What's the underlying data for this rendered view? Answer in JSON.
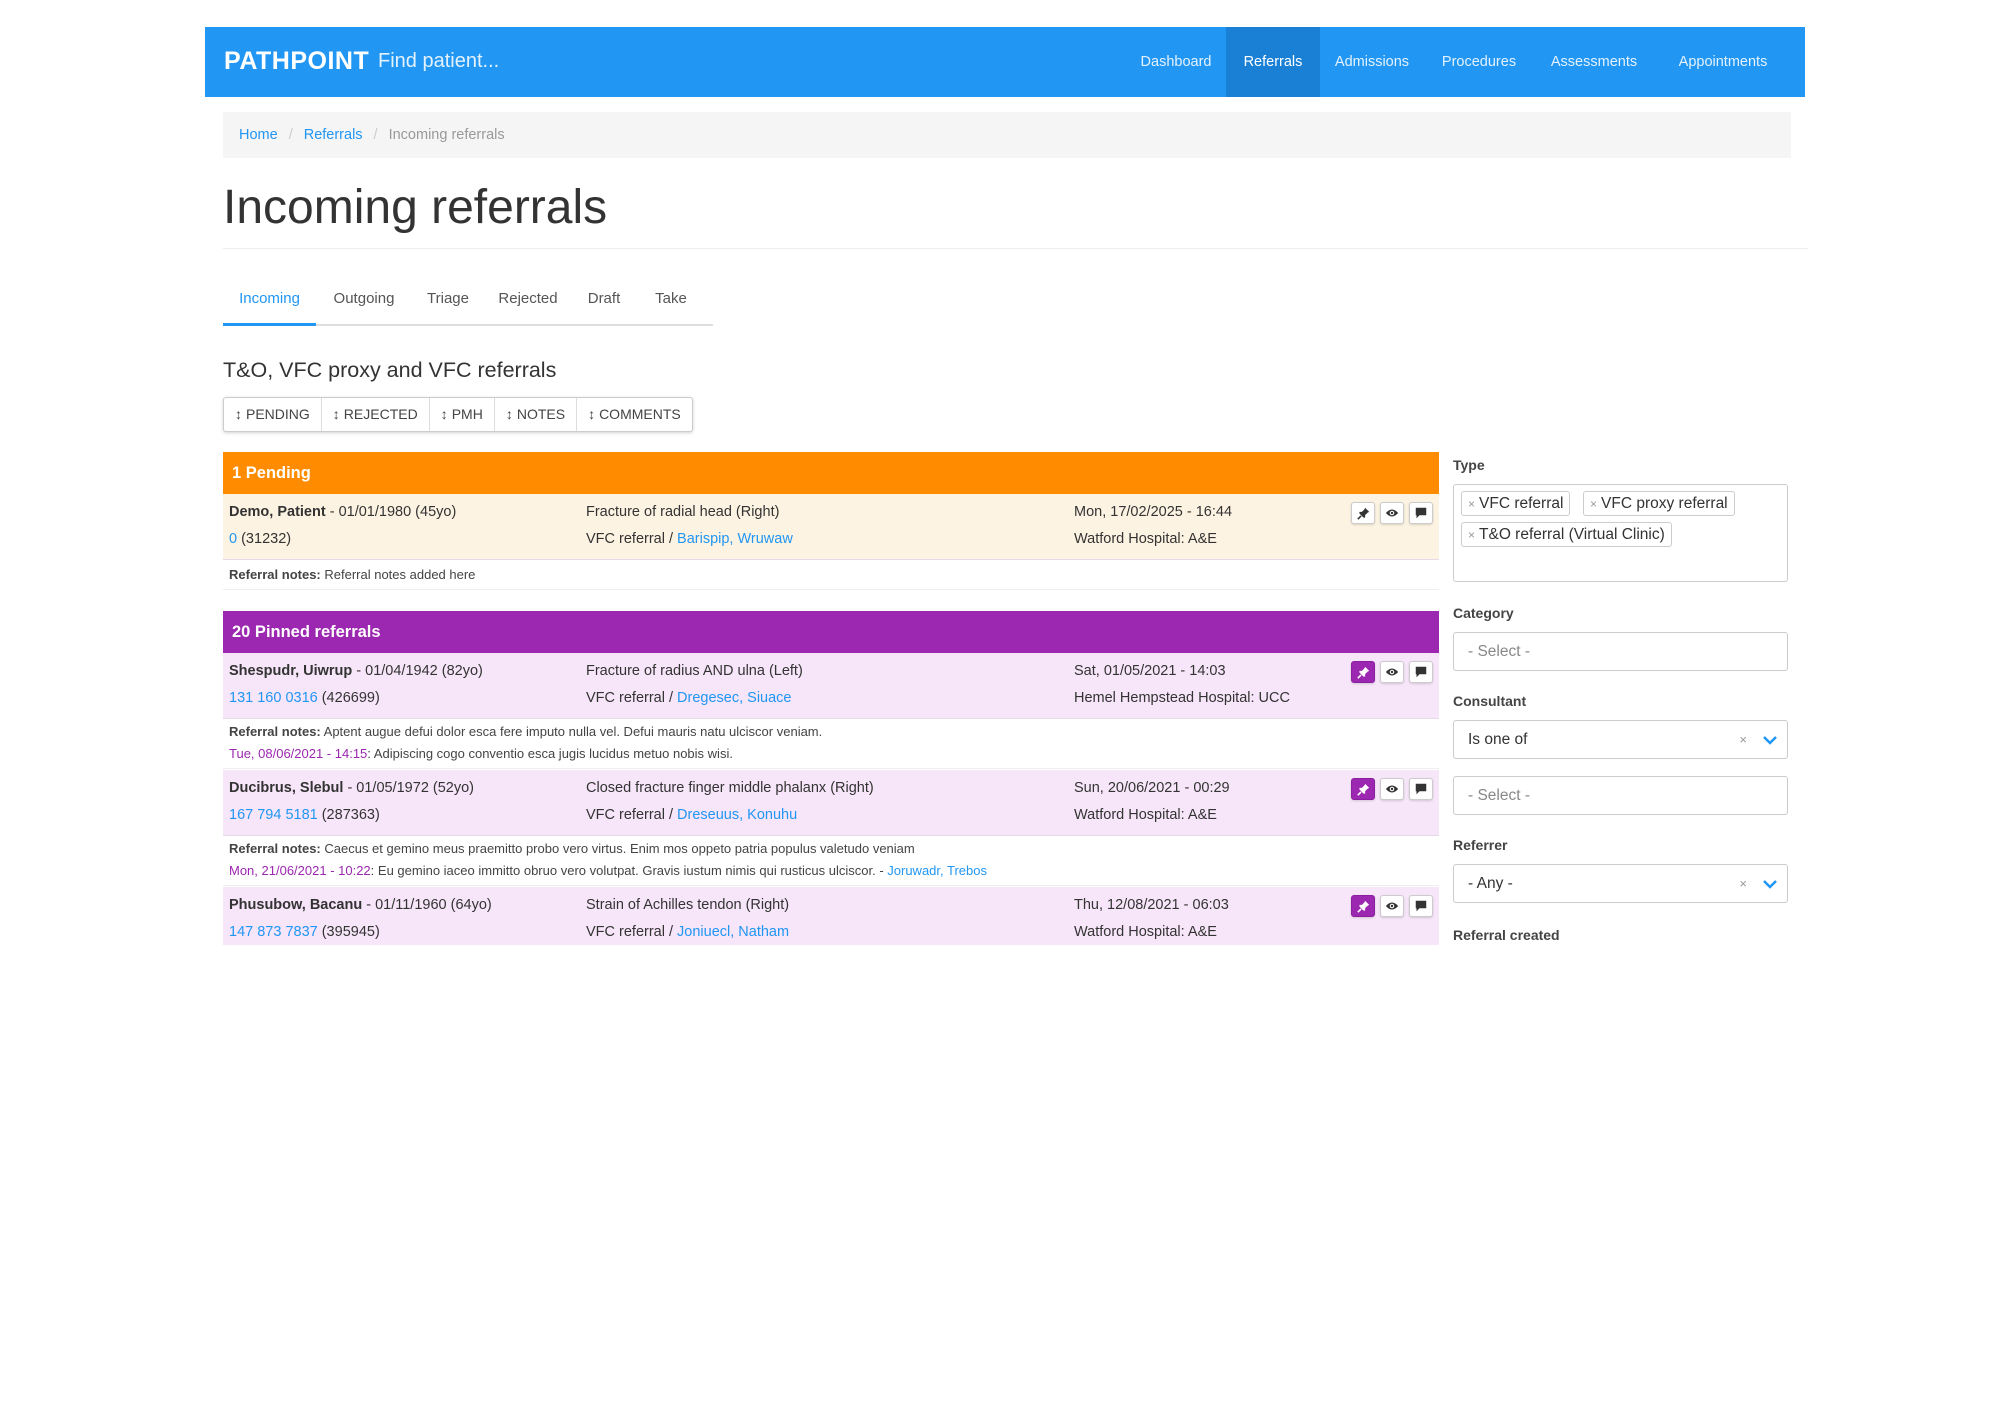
{
  "nav": {
    "brand": "PATHPOINT",
    "find_placeholder": "Find patient...",
    "items": [
      "Dashboard",
      "Referrals",
      "Admissions",
      "Procedures",
      "Assessments",
      "Appointments"
    ],
    "active_item": "Referrals"
  },
  "breadcrumb": {
    "home": "Home",
    "referrals": "Referrals",
    "current": "Incoming referrals"
  },
  "page_title": "Incoming referrals",
  "tabs": [
    "Incoming",
    "Outgoing",
    "Triage",
    "Rejected",
    "Draft",
    "Take"
  ],
  "active_tab": "Incoming",
  "section_title": "T&O, VFC proxy and VFC referrals",
  "sort_buttons": [
    "PENDING",
    "REJECTED",
    "PMH",
    "NOTES",
    "COMMENTS"
  ],
  "colors": {
    "nav": "#2196f3",
    "pending": "#ff8c00",
    "pinned": "#9c27b0",
    "pending_row": "#fdf3e2",
    "pinned_row": "#f7e6f9",
    "link": "#2196f3"
  },
  "pending": {
    "header": "1 Pending",
    "rows": [
      {
        "name": "Demo, Patient",
        "dob": " - 01/01/1980 (45yo)",
        "id_link": "0",
        "id_extra": " (31232)",
        "diagnosis": "Fracture of radial head (Right)",
        "type_prefix": "VFC referral / ",
        "referrer": "Barispip, Wruwaw",
        "datetime": "Mon, 17/02/2025 - 16:44",
        "location": "Watford Hospital: A&E",
        "notes_label": "Referral notes:",
        "notes": " Referral notes added here"
      }
    ]
  },
  "pinned": {
    "header": "20 Pinned referrals",
    "rows": [
      {
        "name": "Shespudr, Uiwrup",
        "dob": " - 01/04/1942 (82yo)",
        "id_link": "131 160 0316",
        "id_extra": " (426699)",
        "diagnosis": "Fracture of radius AND ulna (Left)",
        "type_prefix": "VFC referral / ",
        "referrer": "Dregesec, Siuace",
        "datetime": "Sat, 01/05/2021 - 14:03",
        "location": "Hemel Hempstead Hospital: UCC",
        "notes_label": "Referral notes:",
        "notes": " Aptent augue defui dolor esca fere imputo nulla vel. Defui mauris natu ulciscor veniam.",
        "comment_date": "Tue, 08/06/2021 - 14:15",
        "comment": ": Adipiscing cogo conventio esca jugis lucidus metuo nobis wisi.",
        "comment_author": ""
      },
      {
        "name": "Ducibrus, Slebul",
        "dob": " - 01/05/1972 (52yo)",
        "id_link": "167 794 5181",
        "id_extra": " (287363)",
        "diagnosis": "Closed fracture finger middle phalanx (Right)",
        "type_prefix": "VFC referral / ",
        "referrer": "Dreseuus, Konuhu",
        "datetime": "Sun, 20/06/2021 - 00:29",
        "location": "Watford Hospital: A&E",
        "notes_label": "Referral notes:",
        "notes": " Caecus et gemino meus praemitto probo vero virtus. Enim mos oppeto patria populus valetudo veniam",
        "comment_date": "Mon, 21/06/2021 - 10:22",
        "comment": ": Eu gemino iaceo immitto obruo vero volutpat. Gravis iustum nimis qui rusticus ulciscor. - ",
        "comment_author": "Joruwadr, Trebos"
      },
      {
        "name": "Phusubow, Bacanu",
        "dob": " - 01/11/1960 (64yo)",
        "id_link": "147 873 7837",
        "id_extra": " (395945)",
        "diagnosis": "Strain of Achilles tendon (Right)",
        "type_prefix": "VFC referral / ",
        "referrer": "Joniuecl, Natham",
        "datetime": "Thu, 12/08/2021 - 06:03",
        "location": "Watford Hospital: A&E"
      }
    ]
  },
  "filters": {
    "type_label": "Type",
    "type_chips": [
      "VFC referral",
      "VFC proxy referral",
      "T&O referral (Virtual Clinic)"
    ],
    "category_label": "Category",
    "category_placeholder": "- Select -",
    "consultant_label": "Consultant",
    "consultant_operator": "Is one of",
    "consultant_placeholder": "- Select -",
    "referrer_label": "Referrer",
    "referrer_value": "- Any -",
    "created_label": "Referral created"
  }
}
